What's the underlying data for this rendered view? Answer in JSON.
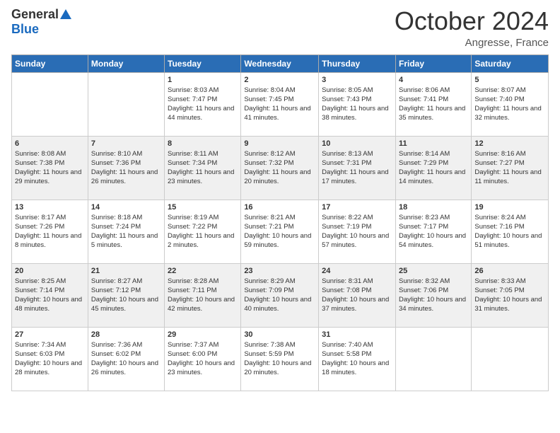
{
  "header": {
    "logo_general": "General",
    "logo_blue": "Blue",
    "month": "October 2024",
    "location": "Angresse, France"
  },
  "days_of_week": [
    "Sunday",
    "Monday",
    "Tuesday",
    "Wednesday",
    "Thursday",
    "Friday",
    "Saturday"
  ],
  "weeks": [
    [
      {
        "day": "",
        "sunrise": "",
        "sunset": "",
        "daylight": ""
      },
      {
        "day": "",
        "sunrise": "",
        "sunset": "",
        "daylight": ""
      },
      {
        "day": "1",
        "sunrise": "Sunrise: 8:03 AM",
        "sunset": "Sunset: 7:47 PM",
        "daylight": "Daylight: 11 hours and 44 minutes."
      },
      {
        "day": "2",
        "sunrise": "Sunrise: 8:04 AM",
        "sunset": "Sunset: 7:45 PM",
        "daylight": "Daylight: 11 hours and 41 minutes."
      },
      {
        "day": "3",
        "sunrise": "Sunrise: 8:05 AM",
        "sunset": "Sunset: 7:43 PM",
        "daylight": "Daylight: 11 hours and 38 minutes."
      },
      {
        "day": "4",
        "sunrise": "Sunrise: 8:06 AM",
        "sunset": "Sunset: 7:41 PM",
        "daylight": "Daylight: 11 hours and 35 minutes."
      },
      {
        "day": "5",
        "sunrise": "Sunrise: 8:07 AM",
        "sunset": "Sunset: 7:40 PM",
        "daylight": "Daylight: 11 hours and 32 minutes."
      }
    ],
    [
      {
        "day": "6",
        "sunrise": "Sunrise: 8:08 AM",
        "sunset": "Sunset: 7:38 PM",
        "daylight": "Daylight: 11 hours and 29 minutes."
      },
      {
        "day": "7",
        "sunrise": "Sunrise: 8:10 AM",
        "sunset": "Sunset: 7:36 PM",
        "daylight": "Daylight: 11 hours and 26 minutes."
      },
      {
        "day": "8",
        "sunrise": "Sunrise: 8:11 AM",
        "sunset": "Sunset: 7:34 PM",
        "daylight": "Daylight: 11 hours and 23 minutes."
      },
      {
        "day": "9",
        "sunrise": "Sunrise: 8:12 AM",
        "sunset": "Sunset: 7:32 PM",
        "daylight": "Daylight: 11 hours and 20 minutes."
      },
      {
        "day": "10",
        "sunrise": "Sunrise: 8:13 AM",
        "sunset": "Sunset: 7:31 PM",
        "daylight": "Daylight: 11 hours and 17 minutes."
      },
      {
        "day": "11",
        "sunrise": "Sunrise: 8:14 AM",
        "sunset": "Sunset: 7:29 PM",
        "daylight": "Daylight: 11 hours and 14 minutes."
      },
      {
        "day": "12",
        "sunrise": "Sunrise: 8:16 AM",
        "sunset": "Sunset: 7:27 PM",
        "daylight": "Daylight: 11 hours and 11 minutes."
      }
    ],
    [
      {
        "day": "13",
        "sunrise": "Sunrise: 8:17 AM",
        "sunset": "Sunset: 7:26 PM",
        "daylight": "Daylight: 11 hours and 8 minutes."
      },
      {
        "day": "14",
        "sunrise": "Sunrise: 8:18 AM",
        "sunset": "Sunset: 7:24 PM",
        "daylight": "Daylight: 11 hours and 5 minutes."
      },
      {
        "day": "15",
        "sunrise": "Sunrise: 8:19 AM",
        "sunset": "Sunset: 7:22 PM",
        "daylight": "Daylight: 11 hours and 2 minutes."
      },
      {
        "day": "16",
        "sunrise": "Sunrise: 8:21 AM",
        "sunset": "Sunset: 7:21 PM",
        "daylight": "Daylight: 10 hours and 59 minutes."
      },
      {
        "day": "17",
        "sunrise": "Sunrise: 8:22 AM",
        "sunset": "Sunset: 7:19 PM",
        "daylight": "Daylight: 10 hours and 57 minutes."
      },
      {
        "day": "18",
        "sunrise": "Sunrise: 8:23 AM",
        "sunset": "Sunset: 7:17 PM",
        "daylight": "Daylight: 10 hours and 54 minutes."
      },
      {
        "day": "19",
        "sunrise": "Sunrise: 8:24 AM",
        "sunset": "Sunset: 7:16 PM",
        "daylight": "Daylight: 10 hours and 51 minutes."
      }
    ],
    [
      {
        "day": "20",
        "sunrise": "Sunrise: 8:25 AM",
        "sunset": "Sunset: 7:14 PM",
        "daylight": "Daylight: 10 hours and 48 minutes."
      },
      {
        "day": "21",
        "sunrise": "Sunrise: 8:27 AM",
        "sunset": "Sunset: 7:12 PM",
        "daylight": "Daylight: 10 hours and 45 minutes."
      },
      {
        "day": "22",
        "sunrise": "Sunrise: 8:28 AM",
        "sunset": "Sunset: 7:11 PM",
        "daylight": "Daylight: 10 hours and 42 minutes."
      },
      {
        "day": "23",
        "sunrise": "Sunrise: 8:29 AM",
        "sunset": "Sunset: 7:09 PM",
        "daylight": "Daylight: 10 hours and 40 minutes."
      },
      {
        "day": "24",
        "sunrise": "Sunrise: 8:31 AM",
        "sunset": "Sunset: 7:08 PM",
        "daylight": "Daylight: 10 hours and 37 minutes."
      },
      {
        "day": "25",
        "sunrise": "Sunrise: 8:32 AM",
        "sunset": "Sunset: 7:06 PM",
        "daylight": "Daylight: 10 hours and 34 minutes."
      },
      {
        "day": "26",
        "sunrise": "Sunrise: 8:33 AM",
        "sunset": "Sunset: 7:05 PM",
        "daylight": "Daylight: 10 hours and 31 minutes."
      }
    ],
    [
      {
        "day": "27",
        "sunrise": "Sunrise: 7:34 AM",
        "sunset": "Sunset: 6:03 PM",
        "daylight": "Daylight: 10 hours and 28 minutes."
      },
      {
        "day": "28",
        "sunrise": "Sunrise: 7:36 AM",
        "sunset": "Sunset: 6:02 PM",
        "daylight": "Daylight: 10 hours and 26 minutes."
      },
      {
        "day": "29",
        "sunrise": "Sunrise: 7:37 AM",
        "sunset": "Sunset: 6:00 PM",
        "daylight": "Daylight: 10 hours and 23 minutes."
      },
      {
        "day": "30",
        "sunrise": "Sunrise: 7:38 AM",
        "sunset": "Sunset: 5:59 PM",
        "daylight": "Daylight: 10 hours and 20 minutes."
      },
      {
        "day": "31",
        "sunrise": "Sunrise: 7:40 AM",
        "sunset": "Sunset: 5:58 PM",
        "daylight": "Daylight: 10 hours and 18 minutes."
      },
      {
        "day": "",
        "sunrise": "",
        "sunset": "",
        "daylight": ""
      },
      {
        "day": "",
        "sunrise": "",
        "sunset": "",
        "daylight": ""
      }
    ]
  ]
}
